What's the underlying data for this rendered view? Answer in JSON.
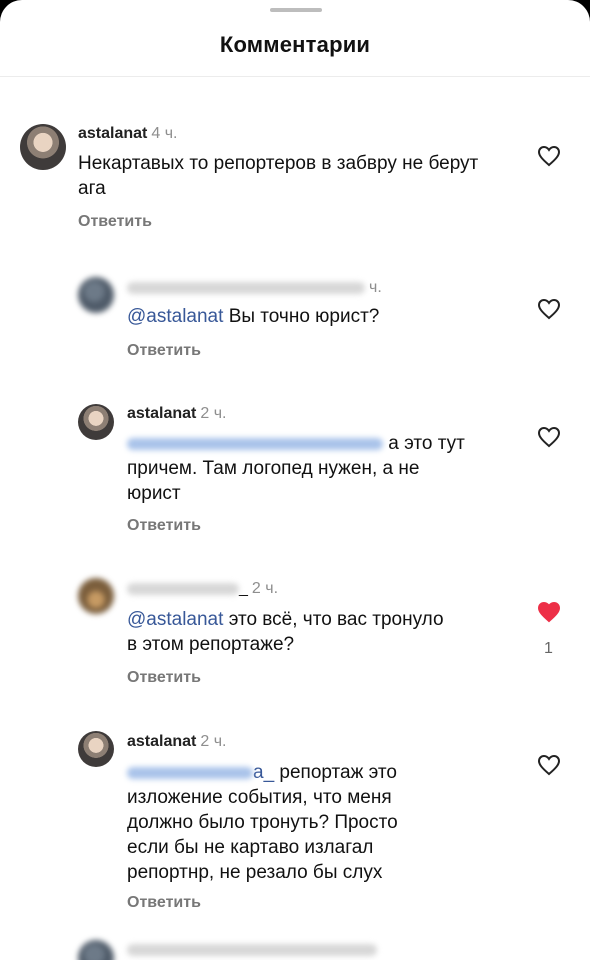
{
  "header": {
    "title": "Комментарии"
  },
  "comments": [
    {
      "username": "astalanat",
      "time": "4 ч.",
      "text": "Некартавых то репортеров в забвру не берут ага",
      "reply": "Ответить",
      "liked": false
    },
    {
      "username": "",
      "time": "ч.",
      "mention": "@astalanat",
      "text": "Вы точно юрист?",
      "reply": "Ответить",
      "liked": false
    },
    {
      "username": "astalanat",
      "time": "2 ч.",
      "text_tail": "а это тут",
      "text_line2": "причем. Там логопед нужен, а не",
      "text_line3": "юрист",
      "reply": "Ответить",
      "liked": false
    },
    {
      "username": "_",
      "time": "2 ч.",
      "mention": "@astalanat",
      "text": "это всё, что вас тронуло",
      "text_line2": "в этом репортаже?",
      "reply": "Ответить",
      "liked": true,
      "likes": "1"
    },
    {
      "username": "astalanat",
      "time": "2 ч.",
      "mention_tail": "а_",
      "text": "репортаж это",
      "text_line2": "изложение события, что меня",
      "text_line3": "должно было тронуть? Просто",
      "text_line4": "если бы не картаво излагал",
      "text_line5": "репортнр, не резало бы слух",
      "reply": "Ответить",
      "liked": false
    }
  ]
}
